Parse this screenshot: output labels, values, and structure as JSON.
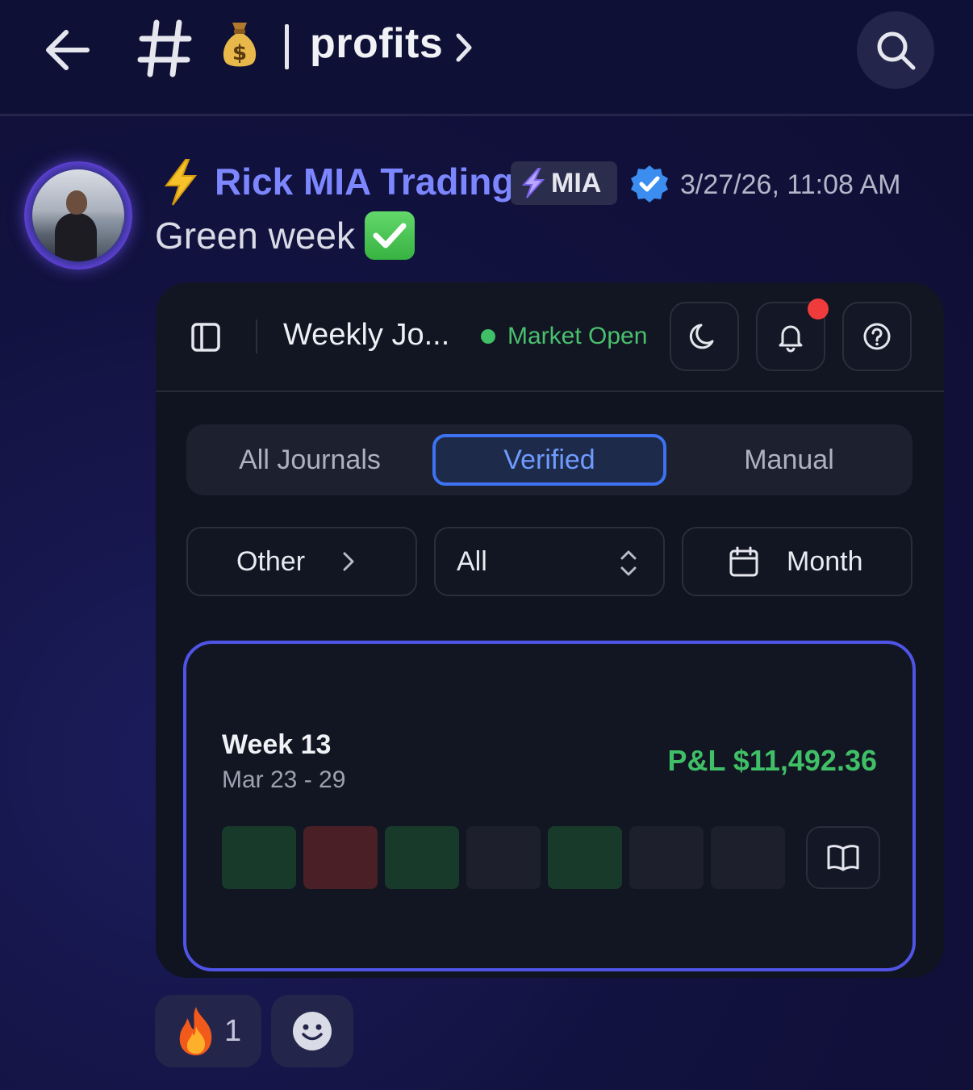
{
  "header": {
    "channel_name": "profits"
  },
  "message": {
    "author": "Rick MIA Trading",
    "role_tag": "MIA",
    "timestamp": "3/27/26, 11:08 AM",
    "text": "Green week"
  },
  "embed": {
    "title": "Weekly Jo...",
    "market_status": "Market Open",
    "segments": [
      "All Journals",
      "Verified",
      "Manual"
    ],
    "active_segment": "Verified",
    "filters": {
      "category": "Other",
      "type": "All",
      "period": "Month"
    },
    "week_card": {
      "title": "Week 13",
      "range": "Mar 23 - 29",
      "pnl": "P&L $11,492.36",
      "days": [
        "profit",
        "loss",
        "profit",
        "none",
        "profit",
        "none",
        "none"
      ]
    }
  },
  "reactions": [
    {
      "emoji": "fire-icon",
      "count": "1"
    }
  ],
  "colors": {
    "accent_blue": "#3d72f0",
    "username": "#7c86ff",
    "profit_green": "#3fbf66",
    "loss_red": "#4a1f26",
    "card_border": "#5054e6"
  }
}
